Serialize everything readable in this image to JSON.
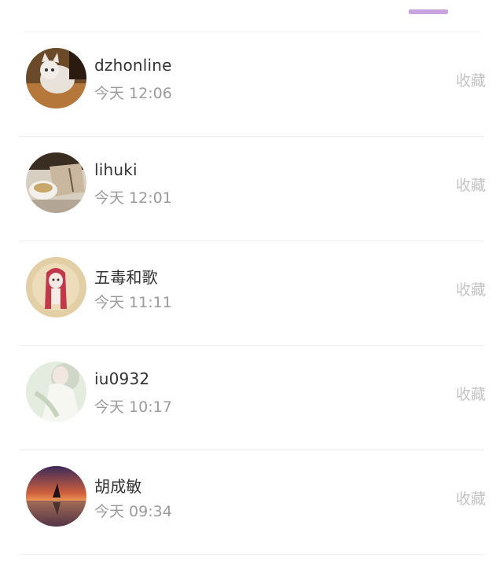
{
  "colors": {
    "accent": "#c9a3e0"
  },
  "list": {
    "items": [
      {
        "name": "dzhonline",
        "time": "今天 12:06",
        "action": "收藏",
        "avatar": "cat-photo-avatar"
      },
      {
        "name": "lihuki",
        "time": "今天 12:01",
        "action": "收藏",
        "avatar": "tea-book-avatar"
      },
      {
        "name": "五毒和歌",
        "time": "今天 11:11",
        "action": "收藏",
        "avatar": "anime-drawing-avatar"
      },
      {
        "name": "iu0932",
        "time": "今天 10:17",
        "action": "收藏",
        "avatar": "girl-photo-avatar"
      },
      {
        "name": "胡成敏",
        "time": "今天 09:34",
        "action": "收藏",
        "avatar": "sunset-photo-avatar"
      }
    ]
  }
}
